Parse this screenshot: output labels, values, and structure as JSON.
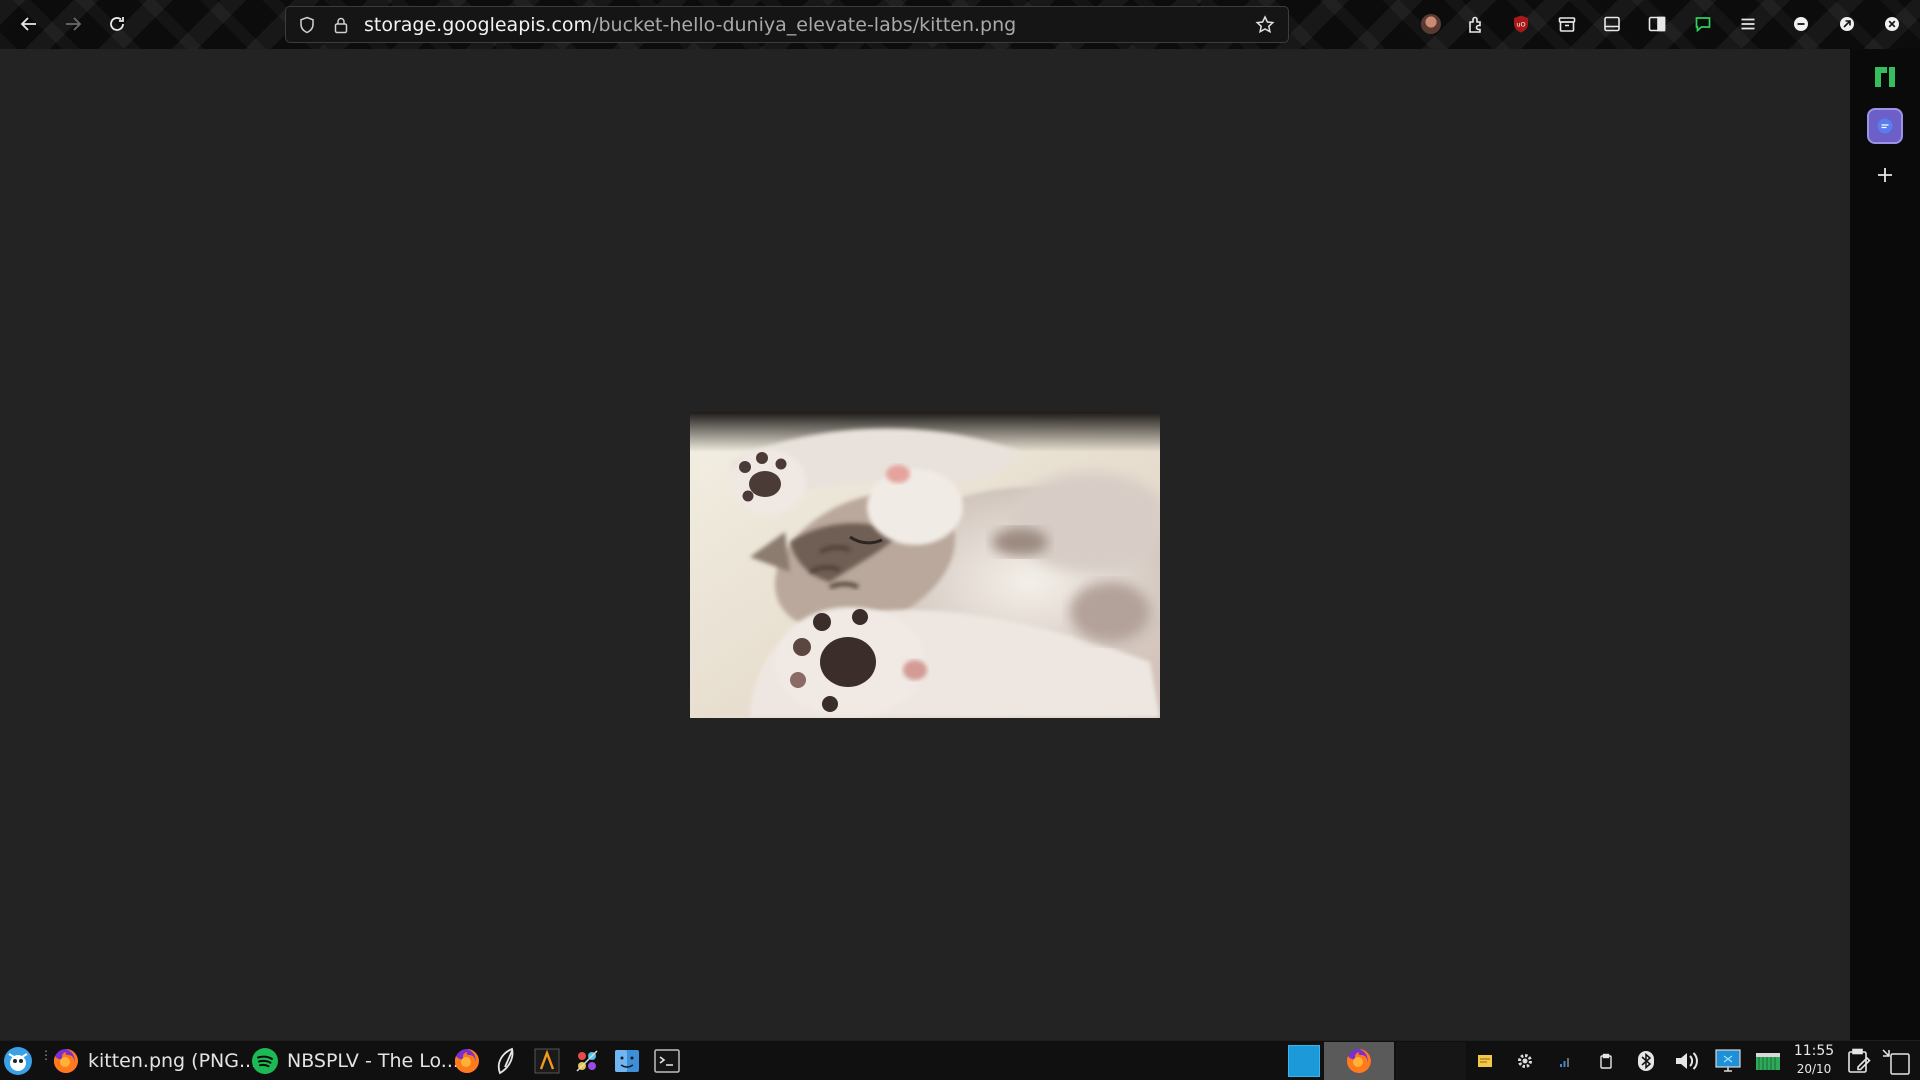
{
  "browser": {
    "url_host": "storage.googleapis.com",
    "url_path": "/bucket-hello-duniya_elevate-labs/kitten.png",
    "toolbar_icons": [
      "back-icon",
      "forward-icon",
      "reload-icon",
      "shield-icon",
      "lock-icon",
      "star-icon",
      "avatar-icon",
      "extensions-icon",
      "ublock-icon",
      "archive-icon",
      "sidebar-toggle-icon",
      "split-view-icon",
      "chat-icon",
      "menu-icon",
      "minimize-icon",
      "restore-icon",
      "close-icon"
    ]
  },
  "content": {
    "image_alt": "kitten.png"
  },
  "sidebar": {
    "items": [
      "manjaro-icon",
      "chat-extension-icon",
      "plus-icon"
    ]
  },
  "taskbar": {
    "tasks": [
      {
        "label": "kitten.png (PNG...",
        "icon": "firefox-icon"
      },
      {
        "label": "NBSPLV - The Lo...",
        "icon": "spotify-icon"
      }
    ],
    "clock_time": "11:55",
    "clock_date": "20/10"
  },
  "colors": {
    "page_bg": "#232323",
    "toolbar_bg": "#0c0c0c",
    "spotify_green": "#1db954",
    "sidebar_accent": "#7b6fd6"
  }
}
